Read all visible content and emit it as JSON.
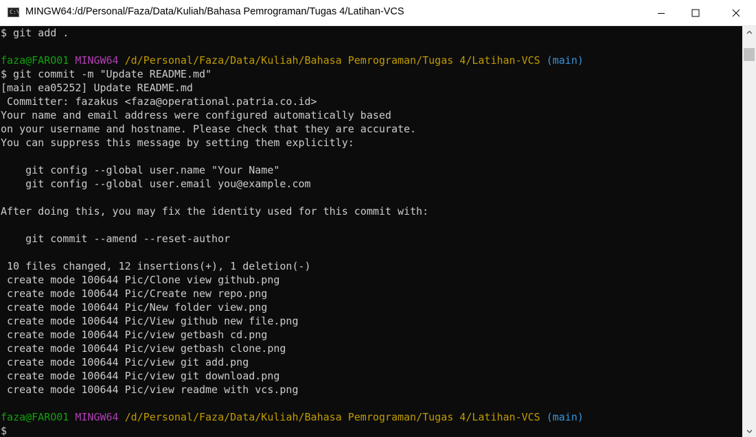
{
  "window": {
    "title": "MINGW64:/d/Personal/Faza/Data/Kuliah/Bahasa Pemrograman/Tugas 4/Latihan-VCS",
    "icon": "C:\\."
  },
  "prompt": {
    "user_host": "faza@FARO01",
    "shell": "MINGW64",
    "path": "/d/Personal/Faza/Data/Kuliah/Bahasa Pemrograman/Tugas 4/Latihan-VCS",
    "branch": "(main)",
    "symbol": "$"
  },
  "lines": [
    "$ git add .",
    "$ git commit -m \"Update README.md\"",
    "[main ea05252] Update README.md",
    " Committer: fazakus <faza@operational.patria.co.id>",
    "Your name and email address were configured automatically based",
    "on your username and hostname. Please check that they are accurate.",
    "You can suppress this message by setting them explicitly:",
    "    git config --global user.name \"Your Name\"",
    "    git config --global user.email you@example.com",
    "After doing this, you may fix the identity used for this commit with:",
    "    git commit --amend --reset-author",
    " 10 files changed, 12 insertions(+), 1 deletion(-)",
    " create mode 100644 Pic/Clone view github.png",
    " create mode 100644 Pic/Create new repo.png",
    " create mode 100644 Pic/New folder view.png",
    " create mode 100644 Pic/View github new file.png",
    " create mode 100644 Pic/view getbash cd.png",
    " create mode 100644 Pic/view getbash clone.png",
    " create mode 100644 Pic/view git add.png",
    " create mode 100644 Pic/view git download.png",
    " create mode 100644 Pic/view readme with vcs.png"
  ],
  "colors": {
    "background": "#0c0c0c",
    "text": "#cccccc",
    "user": "#13a10e",
    "shell": "#b13fb4",
    "path": "#c19c00",
    "branch": "#3a96dd"
  }
}
